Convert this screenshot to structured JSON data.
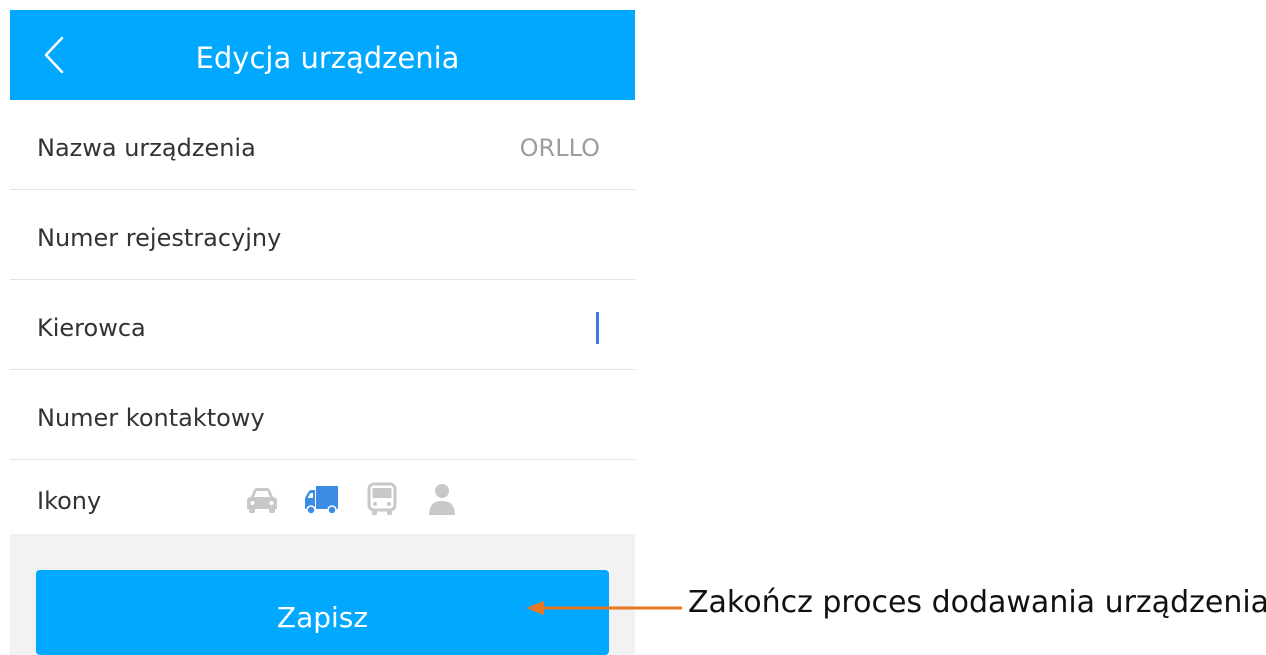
{
  "header": {
    "title": "Edycja urządzenia",
    "back_icon": "chevron-left-icon"
  },
  "form": {
    "rows": [
      {
        "label": "Nazwa urządzenia",
        "value": "ORLLO"
      },
      {
        "label": "Numer rejestracyjny",
        "value": ""
      },
      {
        "label": "Kierowca",
        "value": ""
      },
      {
        "label": "Numer kontaktowy",
        "value": ""
      },
      {
        "label": "Ikony"
      }
    ],
    "icons": [
      {
        "name": "car-icon",
        "selected": false
      },
      {
        "name": "truck-icon",
        "selected": true
      },
      {
        "name": "bus-icon",
        "selected": false
      },
      {
        "name": "person-icon",
        "selected": false
      }
    ]
  },
  "save_label": "Zapisz",
  "annotation": {
    "text": "Zakończ proces dodawania urządzenia",
    "arrow_color": "#e87722"
  },
  "colors": {
    "accent": "#00a8ff",
    "icon_selected": "#3c8ce6",
    "icon_default": "#c8c8c8",
    "caret": "#3c78e6"
  }
}
